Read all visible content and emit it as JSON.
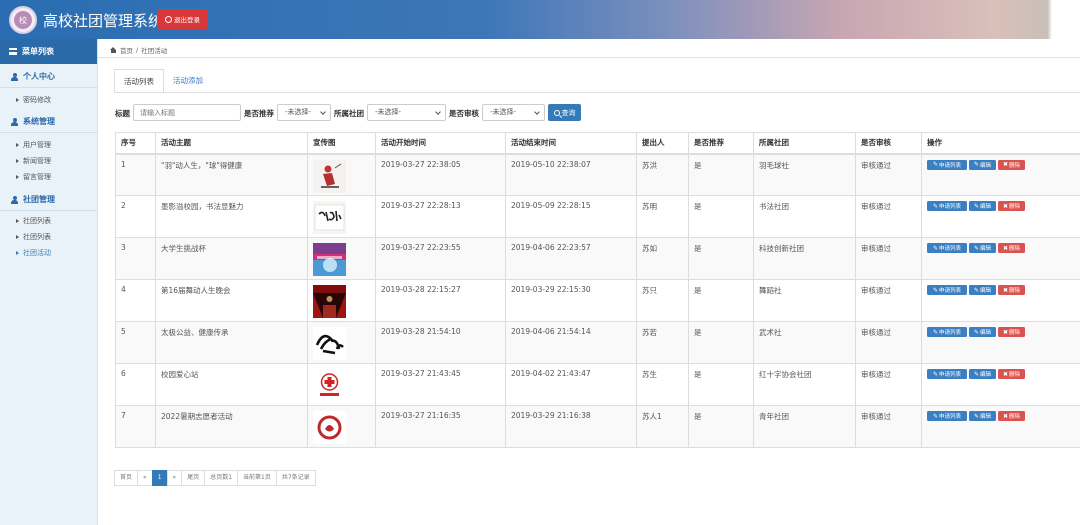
{
  "app": {
    "title": "高校社团管理系统",
    "logo_text": "校",
    "logout_label": "退出登录"
  },
  "sidebar": {
    "menu_title": "菜单列表",
    "groups": [
      {
        "title": "个人中心",
        "items": [
          "密码修改"
        ]
      },
      {
        "title": "系统管理",
        "items": [
          "用户管理",
          "新闻管理",
          "留言管理"
        ]
      },
      {
        "title": "社团管理",
        "items": [
          "社团列表",
          "社团列表",
          "社团活动"
        ]
      }
    ],
    "active_item": "社团活动"
  },
  "breadcrumb": {
    "home": "首页",
    "current": "社团活动"
  },
  "tabs": [
    "活动列表",
    "活动添加"
  ],
  "filters": {
    "title_label": "标题",
    "title_placeholder": "请输入标题",
    "recommend_label": "是否推荐",
    "recommend_value": "-未选择-",
    "club_label": "所属社团",
    "club_value": "-未选择-",
    "audit_label": "是否审核",
    "audit_value": "-未选择-",
    "search_label": "查询"
  },
  "table": {
    "columns": [
      "序号",
      "活动主题",
      "宣传图",
      "活动开始时间",
      "活动结束时间",
      "提出人",
      "是否推荐",
      "所属社团",
      "是否审核",
      "操作"
    ],
    "rows": [
      {
        "no": "1",
        "title": "\"羽\"动人生，\"球\"得健康",
        "start": "2019-03-27 22:38:05",
        "end": "2019-05-10 22:38:07",
        "proposer": "苏洪",
        "recommend": "是",
        "club": "羽毛球社",
        "audit": "审核通过",
        "thumb": "badminton"
      },
      {
        "no": "2",
        "title": "墨影溢校园，书法显魅力",
        "start": "2019-03-27 22:28:13",
        "end": "2019-05-09 22:28:15",
        "proposer": "苏明",
        "recommend": "是",
        "club": "书法社团",
        "audit": "审核通过",
        "thumb": "calligraphy"
      },
      {
        "no": "3",
        "title": "大学生挑战杯",
        "start": "2019-03-27 22:23:55",
        "end": "2019-04-06 22:23:57",
        "proposer": "苏如",
        "recommend": "是",
        "club": "科技创新社团",
        "audit": "审核通过",
        "thumb": "challenge"
      },
      {
        "no": "4",
        "title": "第16届舞动人生晚会",
        "start": "2019-03-28 22:15:27",
        "end": "2019-03-29 22:15:30",
        "proposer": "苏只",
        "recommend": "是",
        "club": "舞蹈社",
        "audit": "审核通过",
        "thumb": "stage"
      },
      {
        "no": "5",
        "title": "太极公益、健康传承",
        "start": "2019-03-28 21:54:10",
        "end": "2019-04-06 21:54:14",
        "proposer": "苏若",
        "recommend": "是",
        "club": "武术社",
        "audit": "审核通过",
        "thumb": "martial"
      },
      {
        "no": "6",
        "title": "校园爱心站",
        "start": "2019-03-27 21:43:45",
        "end": "2019-04-02 21:43:47",
        "proposer": "苏生",
        "recommend": "是",
        "club": "红十字协会社团",
        "audit": "审核通过",
        "thumb": "redcross"
      },
      {
        "no": "7",
        "title": "2022暑期志愿者活动",
        "start": "2019-03-27 21:16:35",
        "end": "2019-03-29 21:16:38",
        "proposer": "苏人1",
        "recommend": "是",
        "club": "青年社团",
        "audit": "审核通过",
        "thumb": "volunteer"
      }
    ],
    "actions": {
      "apply_list": "申请列表",
      "edit": "编辑",
      "delete": "删除"
    }
  },
  "pagination": {
    "first": "首页",
    "prev": "«",
    "page": "1",
    "next": "»",
    "last": "尾页",
    "total_pages": "总页数1",
    "current_page": "当前第1页",
    "total_records": "共7条记录"
  },
  "colors": {
    "primary": "#337ab7",
    "danger": "#d9534f",
    "success": "#3c9a3c",
    "sidebar_bg": "#e9f2f9"
  }
}
